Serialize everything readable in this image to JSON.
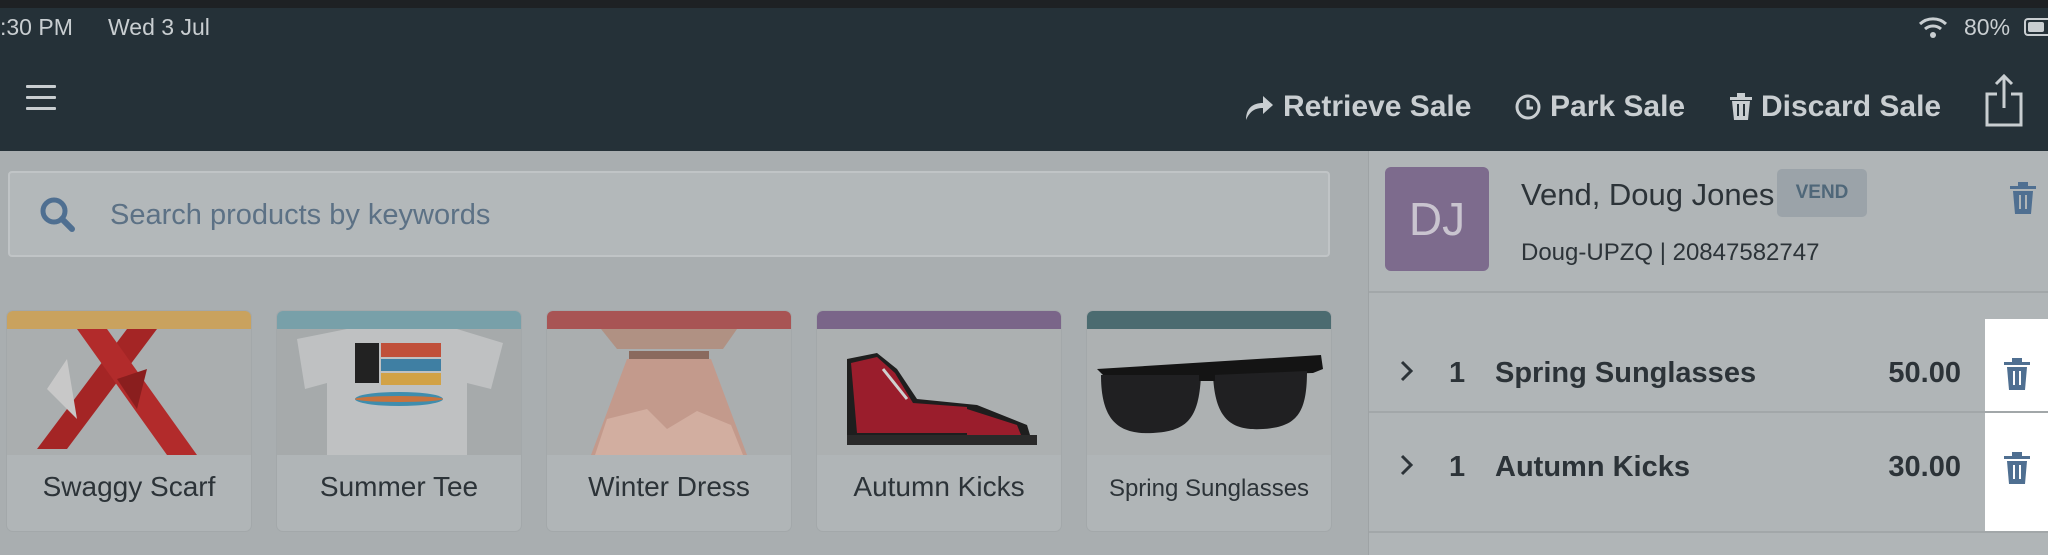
{
  "status_bar": {
    "time": ":30 PM",
    "date": "Wed 3 Jul",
    "battery": "80%",
    "battery_level": 0.8
  },
  "navbar": {
    "actions": [
      {
        "label": "Retrieve Sale",
        "icon": "share-arrow-icon"
      },
      {
        "label": "Park Sale",
        "icon": "clock-icon"
      },
      {
        "label": "Discard Sale",
        "icon": "trash-icon"
      }
    ],
    "share_icon": "share-icon",
    "menu_icon": "hamburger-icon"
  },
  "search": {
    "placeholder": "Search products by keywords",
    "value": ""
  },
  "products": [
    {
      "name": "Swaggy Scarf",
      "color": "#c9a25e"
    },
    {
      "name": "Summer Tee",
      "color": "#78a0a9"
    },
    {
      "name": "Winter Dress",
      "color": "#a85454"
    },
    {
      "name": "Autumn Kicks",
      "color": "#7a6589"
    },
    {
      "name": "Spring Sunglasses",
      "color": "#4b6b70"
    }
  ],
  "customer": {
    "initials": "DJ",
    "name": "Vend, Doug Jones",
    "tag": "VEND",
    "code": "Doug-UPZQ | 20847582747",
    "avatar_color": "#7d6b8d"
  },
  "sale_lines": [
    {
      "qty": "1",
      "name": "Spring Sunglasses",
      "price": "50.00"
    },
    {
      "qty": "1",
      "name": "Autumn Kicks",
      "price": "30.00"
    }
  ],
  "colors": {
    "navbar": "#253138",
    "accent_icon": "#4f6f91"
  }
}
